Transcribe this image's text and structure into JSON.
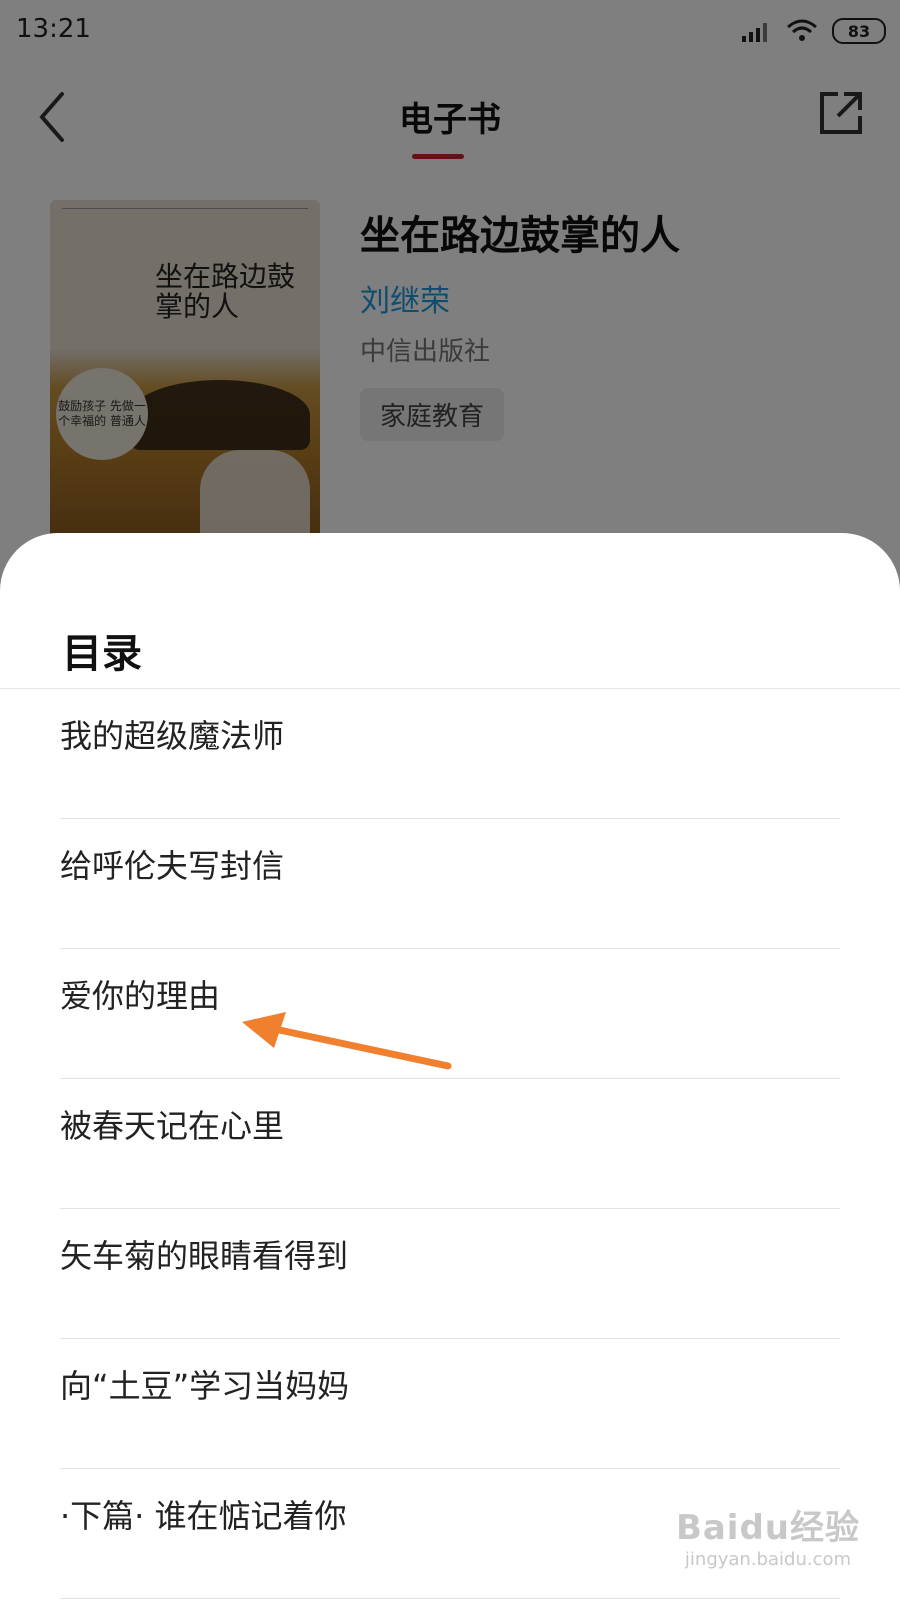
{
  "status_bar": {
    "time": "13:21",
    "battery": "83"
  },
  "nav": {
    "title": "电子书"
  },
  "book": {
    "title": "坐在路边鼓掌的人",
    "author": "刘继荣",
    "publisher": "中信出版社",
    "tag": "家庭教育",
    "cover": {
      "title": "坐在路边鼓掌的人",
      "circle_text": "鼓励孩子 先做一个幸福的 普通人"
    }
  },
  "toc": {
    "title": "目录",
    "items": [
      "我的超级魔法师",
      "给呼伦夫写封信",
      "爱你的理由",
      "被春天记在心里",
      "矢车菊的眼睛看得到",
      "向“土豆”学习当妈妈",
      "·下篇· 谁在惦记着你"
    ]
  },
  "watermark": {
    "logo": "Baidu经验",
    "url": "jingyan.baidu.com"
  },
  "colors": {
    "accent": "#c6242a",
    "author": "#1e9ae0",
    "arrow": "#f07f2e"
  },
  "icons": [
    "signal-icon",
    "wifi-icon",
    "battery-icon",
    "back-arrow-icon",
    "share-icon"
  ]
}
